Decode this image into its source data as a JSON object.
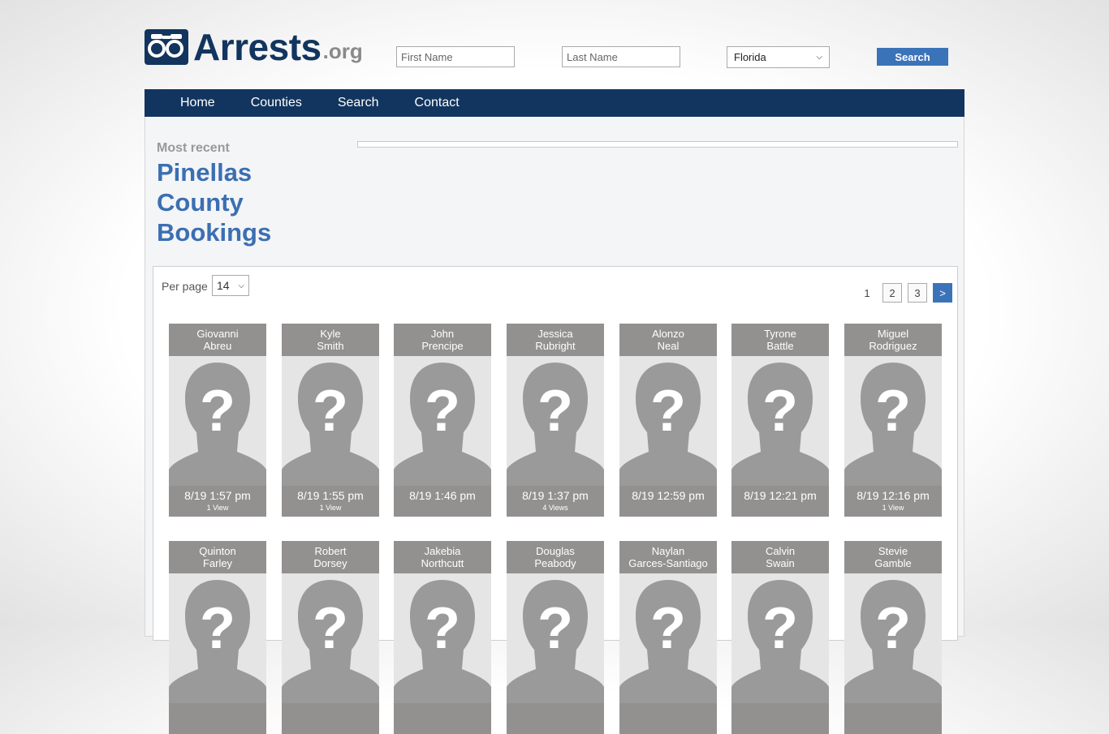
{
  "logo": {
    "text": "Arrests",
    "suffix": ".org"
  },
  "search": {
    "first_placeholder": "First Name",
    "last_placeholder": "Last Name",
    "state": "Florida",
    "button": "Search"
  },
  "nav": [
    "Home",
    "Counties",
    "Search",
    "Contact"
  ],
  "header": {
    "kicker": "Most recent",
    "title_line1": "Pinellas",
    "title_line2": "County",
    "title_line3": "Bookings"
  },
  "controls": {
    "per_page_label": "Per page",
    "per_page_value": "14",
    "pages": [
      "1",
      "2",
      "3"
    ],
    "next": ">"
  },
  "bookings": [
    {
      "first": "Giovanni",
      "last": "Abreu",
      "time": "8/19 1:57 pm",
      "views": "1 View"
    },
    {
      "first": "Kyle",
      "last": "Smith",
      "time": "8/19 1:55 pm",
      "views": "1 View"
    },
    {
      "first": "John",
      "last": "Prencipe",
      "time": "8/19 1:46 pm",
      "views": ""
    },
    {
      "first": "Jessica",
      "last": "Rubright",
      "time": "8/19 1:37 pm",
      "views": "4 Views"
    },
    {
      "first": "Alonzo",
      "last": "Neal",
      "time": "8/19 12:59 pm",
      "views": ""
    },
    {
      "first": "Tyrone",
      "last": "Battle",
      "time": "8/19 12:21 pm",
      "views": ""
    },
    {
      "first": "Miguel",
      "last": "Rodriguez",
      "time": "8/19 12:16 pm",
      "views": "1 View"
    },
    {
      "first": "Quinton",
      "last": "Farley",
      "time": "",
      "views": ""
    },
    {
      "first": "Robert",
      "last": "Dorsey",
      "time": "",
      "views": ""
    },
    {
      "first": "Jakebia",
      "last": "Northcutt",
      "time": "",
      "views": ""
    },
    {
      "first": "Douglas",
      "last": "Peabody",
      "time": "",
      "views": ""
    },
    {
      "first": "Naylan",
      "last": "Garces-Santiago",
      "time": "",
      "views": ""
    },
    {
      "first": "Calvin",
      "last": "Swain",
      "time": "",
      "views": ""
    },
    {
      "first": "Stevie",
      "last": "Gamble",
      "time": "",
      "views": ""
    }
  ]
}
